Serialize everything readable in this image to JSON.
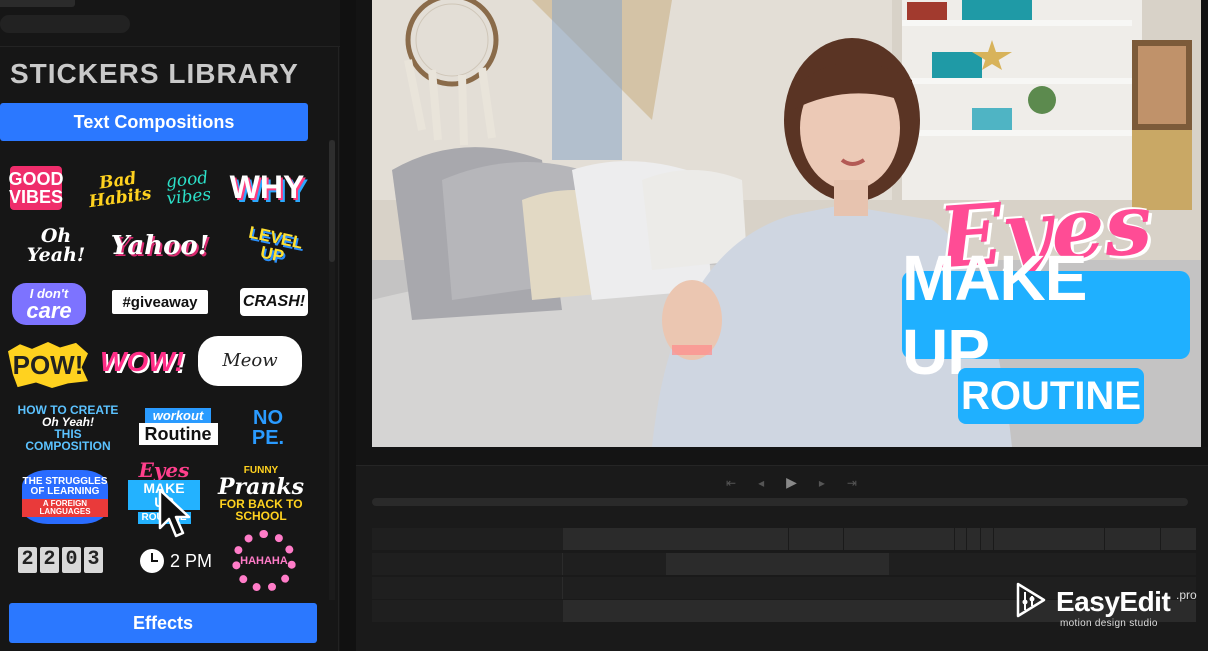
{
  "library": {
    "title": "STICKERS LIBRARY",
    "category_button": "Text Compositions",
    "effects_button": "Effects"
  },
  "stickers": {
    "good_vibes": [
      "GOOD",
      "VIBES"
    ],
    "bad_habits": "Bad Habits",
    "good_vibes_script": "good vibes",
    "why": "WHY",
    "oh_yeah": "Oh Yeah!",
    "yahoo": "Yahoo!",
    "level_up": "LEVEL UP",
    "i_dont_care": [
      "I don't",
      "care"
    ],
    "giveaway": "#giveaway",
    "crash": "CRASH!",
    "pow": "POW!",
    "wow": "WOW!",
    "meow": "Meow",
    "how_to": [
      "HOW TO CREATE",
      "Oh Yeah!",
      "THIS COMPOSITION"
    ],
    "workout": [
      "workout",
      "Routine"
    ],
    "nope": [
      "NO",
      "PE."
    ],
    "struggles": [
      "THE STRUGGLES",
      "OF LEARNING",
      "A FOREIGN LANGUAGES"
    ],
    "eyes_small": [
      "Eyes",
      "MAKE UP",
      "ROUTINE"
    ],
    "funny_pranks": [
      "FUNNY",
      "Pranks",
      "FOR BACK TO SCHOOL"
    ],
    "clock_digits": [
      "2",
      "2",
      "0",
      "3"
    ],
    "clock_time": "2 PM",
    "haha": "HAHAHA"
  },
  "preview_overlay": {
    "line1": "Eyes",
    "line2": "MAKE UP",
    "line3": "ROUTINE"
  },
  "transport": {
    "to_start": "⇤",
    "prev_frame": "◂",
    "play": "▶",
    "next_frame": "▸",
    "to_end": "⇥"
  },
  "brand": {
    "name": "EasyEdit",
    "suffix": ".pro",
    "tagline": "motion design studio"
  },
  "colors": {
    "accent": "#2b78ff",
    "overlay_blue": "#1fb0ff",
    "overlay_pink": "#ff4c95"
  }
}
